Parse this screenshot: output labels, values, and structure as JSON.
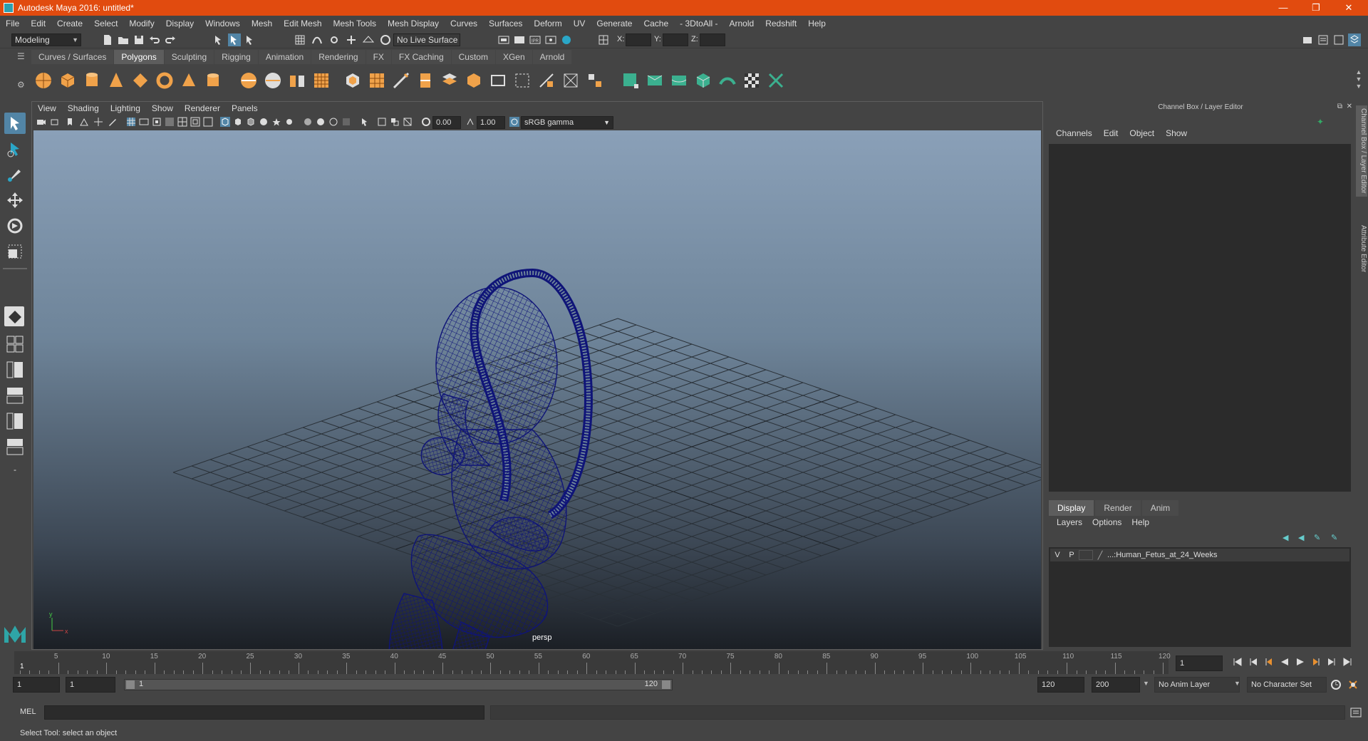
{
  "window": {
    "title": "Autodesk Maya 2016: untitled*",
    "minimize": "—",
    "maximize": "❐",
    "close": "✕"
  },
  "menu": [
    "File",
    "Edit",
    "Create",
    "Select",
    "Modify",
    "Display",
    "Windows",
    "Mesh",
    "Edit Mesh",
    "Mesh Tools",
    "Mesh Display",
    "Curves",
    "Surfaces",
    "Deform",
    "UV",
    "Generate",
    "Cache",
    "- 3DtoAll -",
    "Arnold",
    "Redshift",
    "Help"
  ],
  "status": {
    "mode": "Modeling",
    "live_surface": "No Live Surface",
    "x_label": "X:",
    "y_label": "Y:",
    "z_label": "Z:"
  },
  "shelf_tabs": [
    {
      "label": "Curves / Surfaces",
      "active": false
    },
    {
      "label": "Polygons",
      "active": true
    },
    {
      "label": "Sculpting",
      "active": false
    },
    {
      "label": "Rigging",
      "active": false
    },
    {
      "label": "Animation",
      "active": false
    },
    {
      "label": "Rendering",
      "active": false
    },
    {
      "label": "FX",
      "active": false
    },
    {
      "label": "FX Caching",
      "active": false
    },
    {
      "label": "Custom",
      "active": false
    },
    {
      "label": "XGen",
      "active": false
    },
    {
      "label": "Arnold",
      "active": false
    }
  ],
  "viewport": {
    "menu": [
      "View",
      "Shading",
      "Lighting",
      "Show",
      "Renderer",
      "Panels"
    ],
    "exposure": "0.00",
    "gamma": "1.00",
    "color_space": "sRGB gamma",
    "camera_label": "persp",
    "axis_y": "y",
    "axis_x": "x",
    "wire_color": "#0f1478"
  },
  "channel_box": {
    "header": "Channel Box / Layer Editor",
    "menu": [
      "Channels",
      "Edit",
      "Object",
      "Show"
    ]
  },
  "layer_editor": {
    "tabs": [
      {
        "label": "Display",
        "active": true
      },
      {
        "label": "Render",
        "active": false
      },
      {
        "label": "Anim",
        "active": false
      }
    ],
    "menu": [
      "Layers",
      "Options",
      "Help"
    ],
    "layer": {
      "v": "V",
      "p": "P",
      "name": "...:Human_Fetus_at_24_Weeks"
    }
  },
  "side_tabs": [
    "Channel Box / Layer Editor",
    "Attribute Editor"
  ],
  "timeline": {
    "ticks": [
      5,
      10,
      15,
      20,
      25,
      30,
      35,
      40,
      45,
      50,
      55,
      60,
      65,
      70,
      75,
      80,
      85,
      90,
      95,
      100,
      105,
      110,
      115,
      120
    ],
    "start_marker": "1",
    "current_frame": "1"
  },
  "range": {
    "start": "1",
    "anim_start": "1",
    "slider_start": "1",
    "slider_end": "120",
    "anim_end": "120",
    "end": "200",
    "anim_layer": "No Anim Layer",
    "char_set": "No Character Set"
  },
  "command": {
    "label": "MEL"
  },
  "help_line": "Select Tool: select an object"
}
